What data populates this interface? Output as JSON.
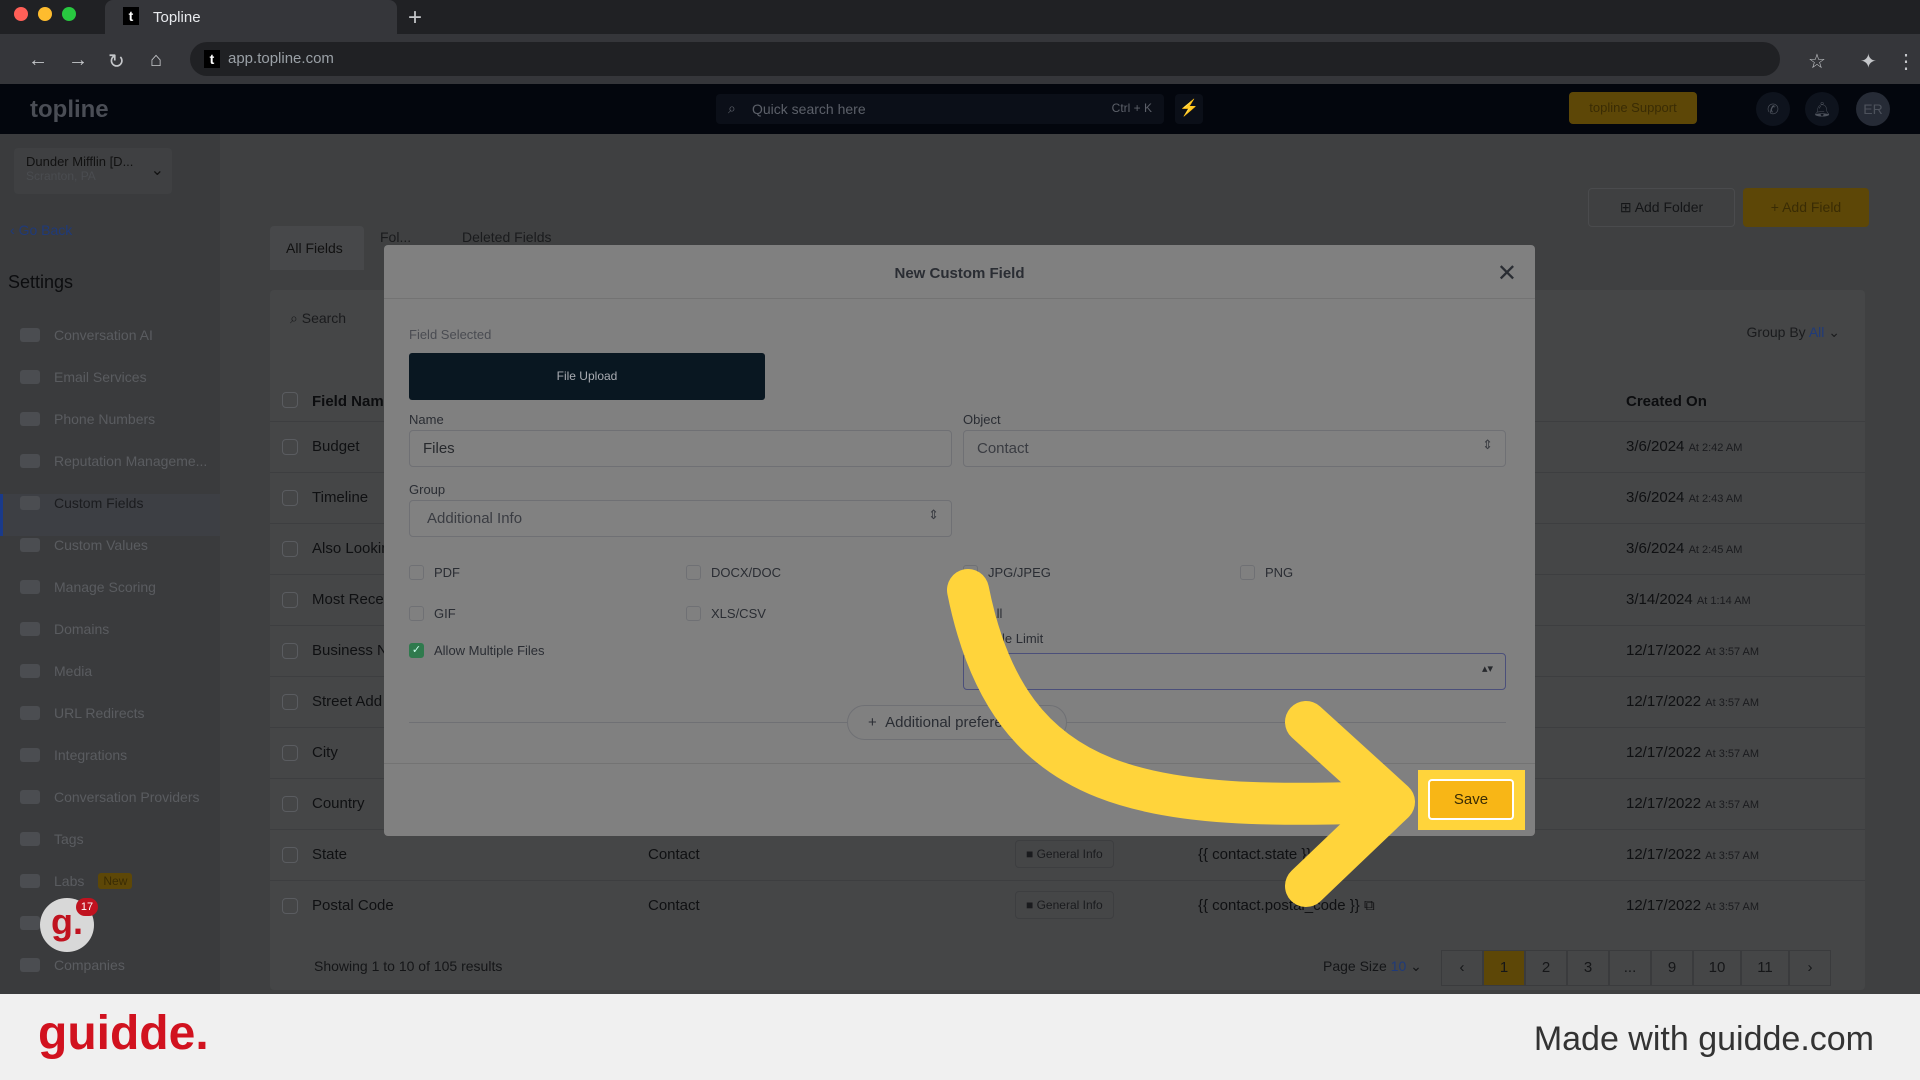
{
  "browser": {
    "tab_title": "Topline",
    "url": "app.topline.com",
    "new_tab": "+"
  },
  "header": {
    "logo": "topline",
    "search_placeholder": "Quick search here",
    "search_shortcut": "Ctrl + K",
    "support": "topline Support",
    "avatar": "ER"
  },
  "sidebar": {
    "account_name": "Dunder Mifflin [D...",
    "account_location": "Scranton, PA",
    "go_back": "Go Back",
    "title": "Settings",
    "items": [
      {
        "label": "Conversation AI"
      },
      {
        "label": "Email Services"
      },
      {
        "label": "Phone Numbers"
      },
      {
        "label": "Reputation Manageme..."
      },
      {
        "label": "Custom Fields"
      },
      {
        "label": "Custom Values"
      },
      {
        "label": "Manage Scoring"
      },
      {
        "label": "Domains"
      },
      {
        "label": "Media"
      },
      {
        "label": "URL Redirects"
      },
      {
        "label": "Integrations"
      },
      {
        "label": "Conversation Providers"
      },
      {
        "label": "Tags"
      },
      {
        "label": "Labs"
      },
      {
        "label": "...ogs"
      },
      {
        "label": "Companies"
      }
    ],
    "labs_badge": "New",
    "guidde_badge": "17"
  },
  "main": {
    "tabs": [
      "All Fields",
      "Fol...",
      "Deleted Fields"
    ],
    "add_folder": "Add Folder",
    "add_field": "+ Add Field",
    "search_placeholder": "Search",
    "group_by_label": "Group By",
    "group_by_value": "All",
    "columns": {
      "name": "Field Nam",
      "created": "Created On"
    },
    "rows": [
      {
        "name": "Budget",
        "object": "",
        "group": "",
        "key": "",
        "date": "3/6/2024",
        "time": "At 2:42 AM"
      },
      {
        "name": "Timeline",
        "object": "",
        "group": "",
        "key": "",
        "date": "3/6/2024",
        "time": "At 2:43 AM"
      },
      {
        "name": "Also Lookin",
        "object": "",
        "group": "",
        "key": "",
        "date": "3/6/2024",
        "time": "At 2:45 AM"
      },
      {
        "name": "Most Rece",
        "object": "",
        "group": "",
        "key": "",
        "date": "3/14/2024",
        "time": "At 1:14 AM"
      },
      {
        "name": "Business N",
        "object": "",
        "group": "",
        "key": "",
        "date": "12/17/2022",
        "time": "At 3:57 AM"
      },
      {
        "name": "Street Add",
        "object": "",
        "group": "",
        "key": "",
        "date": "12/17/2022",
        "time": "At 3:57 AM"
      },
      {
        "name": "City",
        "object": "",
        "group": "",
        "key": "",
        "date": "12/17/2022",
        "time": "At 3:57 AM"
      },
      {
        "name": "Country",
        "object": "",
        "group": "",
        "key": "",
        "date": "12/17/2022",
        "time": "At 3:57 AM"
      },
      {
        "name": "State",
        "object": "Contact",
        "group": "General Info",
        "key": "{{ contact.state }}",
        "date": "12/17/2022",
        "time": "At 3:57 AM"
      },
      {
        "name": "Postal Code",
        "object": "Contact",
        "group": "General Info",
        "key": "{{ contact.postal_code }}",
        "date": "12/17/2022",
        "time": "At 3:57 AM"
      }
    ],
    "showing": "Showing 1 to 10 of 105 results",
    "page_size_label": "Page Size",
    "page_size": "10",
    "pages": [
      "‹",
      "1",
      "2",
      "3",
      "...",
      "9",
      "10",
      "11",
      "›"
    ],
    "current_page": "1"
  },
  "modal": {
    "title": "New Custom Field",
    "field_selected_label": "Field Selected",
    "field_type": "File Upload",
    "name_label": "Name",
    "name_value": "Files",
    "object_label": "Object",
    "object_value": "Contact",
    "group_label": "Group",
    "group_value": "Additional Info",
    "file_types": [
      {
        "label": "PDF",
        "checked": false
      },
      {
        "label": "DOCX/DOC",
        "checked": false
      },
      {
        "label": "JPG/JPEG",
        "checked": false
      },
      {
        "label": "PNG",
        "checked": false
      },
      {
        "label": "GIF",
        "checked": false
      },
      {
        "label": "XLS/CSV",
        "checked": false
      },
      {
        "label": "All",
        "checked": false
      }
    ],
    "allow_multiple": {
      "label": "Allow Multiple Files",
      "checked": true
    },
    "limit_label": "Max File Limit",
    "limit_value": "10",
    "additional_prefs": "Additional preferences",
    "save": "Save"
  },
  "footer": {
    "brand": "guidde.",
    "made_with": "Made with guidde.com"
  },
  "colors": {
    "accent": "#fbbf24",
    "annotation_arrow": "#ffd43b",
    "brand_red": "#d1121f"
  }
}
